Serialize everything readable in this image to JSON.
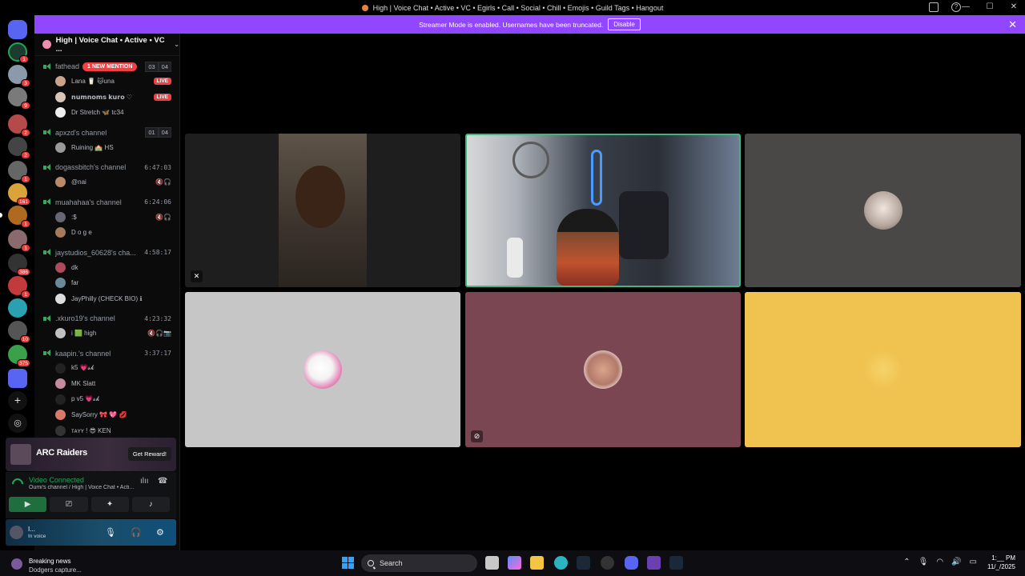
{
  "window": {
    "title": "High | Voice Chat • Active • VC • Egirls • Call • Social • Chill • Emojis • Guild Tags • Hangout"
  },
  "banner": {
    "text": "Streamer Mode is enabled. Usernames have been truncated.",
    "disable_label": "Disable",
    "close_glyph": "✕",
    "color": "#9146ff"
  },
  "rail": {
    "badges": [
      "1",
      "3",
      "9",
      "2",
      "2",
      "1",
      "161",
      "1",
      "1",
      "386",
      "1",
      "10",
      "375"
    ]
  },
  "sidebar": {
    "server_name": "High | Voice Chat • Active • VC ...",
    "channels": [
      {
        "name": "fathead",
        "mention": "1 NEW MENTION",
        "count_a": "03",
        "count_b": "04",
        "members": [
          {
            "name": "Lana 🥛 🐱una",
            "live": "LIVE"
          },
          {
            "name": "𝗻𝘂𝗺𝗻𝗼𝗺𝘀 𝗸𝘂𝗿𝗼 ♡",
            "live": "LIVE"
          },
          {
            "name": "Dr Stretch 🦋 tc34",
            "live": ""
          }
        ]
      },
      {
        "name": "apxzd's channel",
        "count_a": "01",
        "count_b": "04",
        "members": [
          {
            "name": "Ruining 🏫 HS",
            "live": ""
          }
        ]
      },
      {
        "name": "dogassbitch's channel",
        "timer": "6:47:03",
        "members": [
          {
            "name": "@nai",
            "icons": "🔇🎧"
          }
        ]
      },
      {
        "name": "muahahaa's channel",
        "timer": "6:24:06",
        "members": [
          {
            "name": ":$",
            "icons": "🔇🎧"
          },
          {
            "name": "D o g e",
            "icons": ""
          }
        ]
      },
      {
        "name": "jaystudios_60628's cha...",
        "timer": "4:58:17",
        "members": [
          {
            "name": "dk"
          },
          {
            "name": "far"
          },
          {
            "name": "JayPhilly (CHECK BIO) ℹ"
          }
        ]
      },
      {
        "name": ".xkuro19's channel",
        "timer": "4:23:32",
        "members": [
          {
            "name": "i 🟩 high",
            "icons": "🔇🎧📷"
          }
        ]
      },
      {
        "name": "kaapin.'s channel",
        "timer": "3:37:17",
        "members": [
          {
            "name": "k5 💗𝓼𝓴"
          },
          {
            "name": "MK Slatt"
          },
          {
            "name": "p v5 💗𝓼𝓴"
          },
          {
            "name": "SaySorry 🎀 💖 💋"
          },
          {
            "name": "ᴛᴀʏʏ ! 😎 KEN"
          }
        ]
      }
    ]
  },
  "ad": {
    "brand": "ARC Raiders",
    "cta": "Get Reward!"
  },
  "voice": {
    "status": "Video Connected",
    "channel": "Oumi's channel / High | Voice Chat • Acti...",
    "user_name": "I...",
    "user_status": "In voice"
  },
  "taskbar": {
    "news_title": "Breaking news",
    "news_sub": "Dodgers capture...",
    "search_placeholder": "Search",
    "time": "1:__ PM",
    "date": "11/_/2025"
  },
  "tiles": [
    {
      "id": "cam-1",
      "kind": "video",
      "bg": "#1e1e1e"
    },
    {
      "id": "cam-2",
      "kind": "video",
      "bg": "#2a2f38",
      "speaking": true
    },
    {
      "id": "avatar-1",
      "kind": "avatar",
      "bg": "#4a4847"
    },
    {
      "id": "avatar-2",
      "kind": "avatar",
      "bg": "#c6c6c6"
    },
    {
      "id": "avatar-3",
      "kind": "avatar",
      "bg": "#7a4651"
    },
    {
      "id": "avatar-4",
      "kind": "avatar",
      "bg": "#f0c350"
    }
  ]
}
